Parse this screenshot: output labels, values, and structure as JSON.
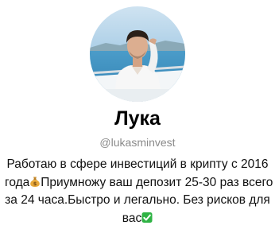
{
  "profile": {
    "name": "Лука",
    "username": "@lukasminvest",
    "bio": {
      "line1": "Работаю в сфере инвестиций в крипту с 2016",
      "line2_before": "года",
      "line2_after": "Приумножу ваш депозит 25-30 раз всего",
      "line3": "за 24 часа.Быстро и легально. Без рисков для",
      "line4": "вас"
    },
    "icons": {
      "avatar": "profile-photo",
      "emoji_1": "money-bag-icon",
      "emoji_2": "check-mark-button-icon"
    }
  },
  "colors": {
    "background": "#ffffff",
    "name": "#000000",
    "username": "#8a8a8a",
    "bio": "#111111",
    "check_emoji": "#2fb344",
    "money_bag_emoji": "#e8a93a"
  }
}
